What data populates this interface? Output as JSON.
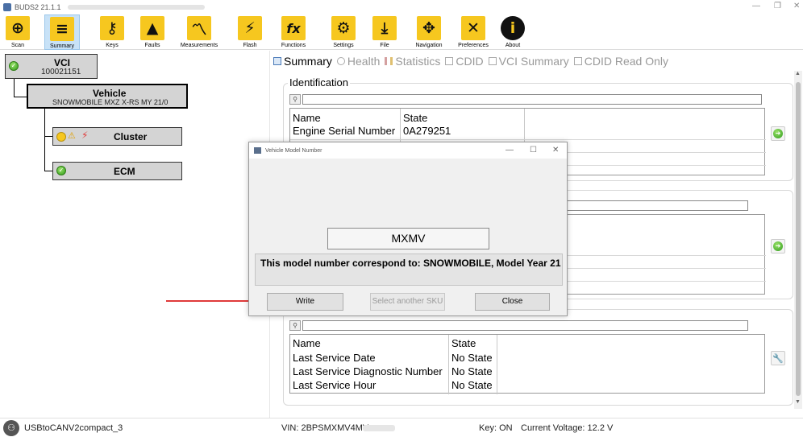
{
  "window": {
    "title": "BUDS2 21.1.1"
  },
  "toolbar": {
    "items": [
      {
        "label": "Scan",
        "icon": "scan-icon",
        "glyph": "⊕"
      },
      {
        "label": "Summary",
        "icon": "summary-icon",
        "glyph": "≡"
      },
      {
        "label": "Keys",
        "icon": "key-icon",
        "glyph": "⚷"
      },
      {
        "label": "Faults",
        "icon": "warning-icon",
        "glyph": "▲"
      },
      {
        "label": "Measurements",
        "icon": "chart-icon",
        "glyph": "〽"
      },
      {
        "label": "Flash",
        "icon": "lightning-icon",
        "glyph": "⚡"
      },
      {
        "label": "Functions",
        "icon": "fx-icon",
        "glyph": "fx"
      },
      {
        "label": "Settings",
        "icon": "gear-icon",
        "glyph": "⚙"
      },
      {
        "label": "File",
        "icon": "download-icon",
        "glyph": "⤓"
      },
      {
        "label": "Navigation",
        "icon": "navigation-icon",
        "glyph": "✥"
      },
      {
        "label": "Preferences",
        "icon": "tools-icon",
        "glyph": "✕"
      },
      {
        "label": "About",
        "icon": "info-icon",
        "glyph": "i"
      }
    ],
    "active": "Summary"
  },
  "tree": {
    "vci": {
      "title": "VCI",
      "serial": "100021151"
    },
    "vehicle": {
      "title": "Vehicle",
      "model": "SNOWMOBILE MXZ X-RS MY 21/0"
    },
    "cluster": {
      "title": "Cluster"
    },
    "ecm": {
      "title": "ECM"
    }
  },
  "tabs": [
    {
      "label": "Summary",
      "active": true
    },
    {
      "label": "Health",
      "active": false
    },
    {
      "label": "Statistics",
      "active": false
    },
    {
      "label": "CDID",
      "active": false
    },
    {
      "label": "VCI Summary",
      "active": false
    },
    {
      "label": "CDID Read Only",
      "active": false
    }
  ],
  "identification": {
    "title": "Identification",
    "headers": [
      "Name",
      "State"
    ],
    "rows": [
      {
        "name": "Engine Serial Number",
        "state": "0A279251"
      }
    ]
  },
  "service": {
    "headers": [
      "Name",
      "State"
    ],
    "rows": [
      {
        "name": "Last Service Date",
        "state": "No State"
      },
      {
        "name": "Last Service Diagnostic Number",
        "state": "No State"
      },
      {
        "name": "Last Service Hour",
        "state": "No State"
      }
    ]
  },
  "dialog": {
    "title": "Vehicle Model Number",
    "model_number": "MXMV",
    "message": "This model number correspond to: SNOWMOBILE, Model Year 21",
    "buttons": {
      "write": "Write",
      "select_sku": "Select another SKU",
      "close": "Close"
    }
  },
  "status": {
    "interface": "USBtoCANV2compact_3",
    "vin": "VIN: 2BPSMXMV4MV",
    "key": "Key: ON",
    "voltage": "Current Voltage: 12.2 V"
  },
  "colors": {
    "toolbar_icon": "#f6c71f",
    "accent_red": "#e03a3a",
    "ok_green": "#2f9b1c"
  }
}
